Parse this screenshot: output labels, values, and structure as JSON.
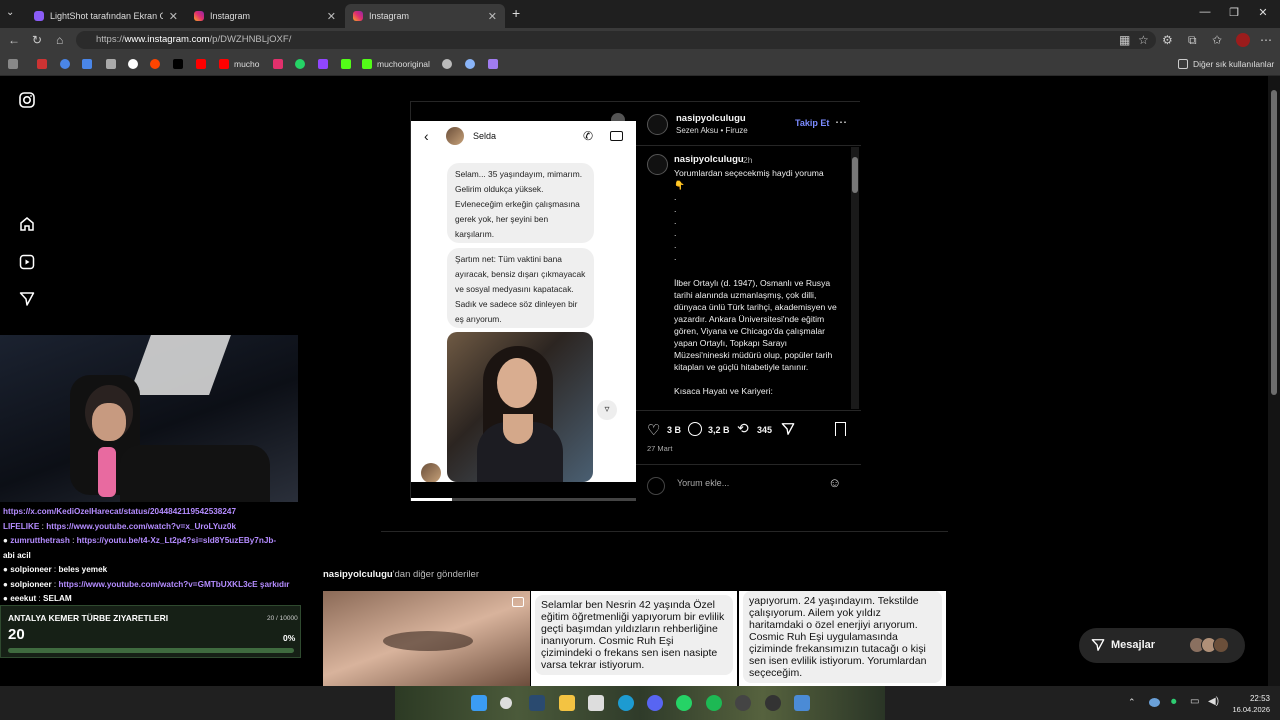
{
  "browser": {
    "tabs": [
      {
        "label": "LightShot tarafından Ekran Görünt",
        "active": false
      },
      {
        "label": "Instagram",
        "active": false
      },
      {
        "label": "Instagram",
        "active": true
      }
    ],
    "url_prefix": "https://",
    "url_domain": "www.instagram.com",
    "url_path": "/p/DWZHNBLjOXF/",
    "bookmarks": [
      "mucho",
      "muchooriginal"
    ],
    "other_bookmarks": "Diğer sık kullanılanlar"
  },
  "post": {
    "chat_contact": "Selda",
    "bubbles": [
      "Selam... 35 yaşındayım, mimarım. Gelirim oldukça yüksek. Evleneceğim erkeğin çalışmasına gerek yok, her şeyini ben karşılarım.",
      "Şartım net: Tüm vaktini bana ayıracak, bensiz dışarı çıkmayacak ve sosyal medyasını kapatacak. Sadık ve sadece söz dinleyen bir eş arıyorum."
    ],
    "author": "nasipyolculugu",
    "music": "Sezen Aksu • Firuze",
    "follow": "Takip Et",
    "caption_time": "2h",
    "caption_lines": [
      "Yorumlardan seçecekmiş haydi yoruma",
      "👇",
      ".",
      ".",
      ".",
      ".",
      ".",
      "."
    ],
    "caption_body": "İlber Ortaylı (d. 1947), Osmanlı ve Rusya tarihi alanında uzmanlaşmış, çok dilli, dünyaca ünlü Türk tarihçi, akademisyen ve yazardır. Ankara Üniversitesi'nde eğitim gören, Viyana ve Chicago'da çalışmalar yapan Ortaylı, Topkapı Sarayı Müzesi'nineski müdürü olup, popüler tarih kitapları ve güçlü hitabetiyle tanınır.",
    "caption_more": "Kısaca Hayatı ve Kariyeri:",
    "likes": "3 B",
    "comments": "3,2 B",
    "reposts": "345",
    "date": "27 Mart",
    "comment_placeholder": "Yorum ekle..."
  },
  "more_posts": {
    "author": "nasipyolculugu",
    "suffix": "'dan diğer gönderiler",
    "tile2": "Selamlar ben Nesrin 42 yaşında Özel eğitim öğretmenliği yapıyorum bir evlilik geçti başımdan yıldızların rehberliğine inanıyorum. Cosmic Ruh Eşi çizimindeki o frekans sen isen nasipte varsa tekrar istiyorum.",
    "tile3": "yapıyorum. 24 yaşındayım. Tekstilde çalışıyorum. Ailem yok yıldız haritamdaki o özel enerjiyi arıyorum. Cosmic Ruh Eşi uygulamasında çiziminde frekansımızın tutacağı o kişi sen isen evlilik istiyorum. Yorumlardan seçeceğim."
  },
  "messages_label": "Mesajlar",
  "stream": {
    "chat": [
      {
        "user": "",
        "text": "https://x.com/KediOzelHarecat/status/2044842119542538247",
        "ucolor": "#b48cff"
      },
      {
        "user": "LIFELIKE",
        "text": "https://www.youtube.com/watch?v=x_UroLYuz0k",
        "ucolor": "#b48cff"
      },
      {
        "user": "zumrutthetrash",
        "text": "https://youtu.be/t4-Xz_Lt2p4?si=sld8Y5uzEBy7nJb-",
        "ucolor": "#b48cff"
      },
      {
        "user": "",
        "text": "abi acil",
        "ucolor": "#ffffff"
      },
      {
        "user": "solpioneer",
        "text": "beles yemek",
        "ucolor": "#ffffff"
      },
      {
        "user": "solpioneer",
        "text": "https://www.youtube.com/watch?v=GMTbUXKL3cE şarkıdır",
        "ucolor": "#ffffff"
      },
      {
        "user": "eeekut",
        "text": "SELAM",
        "ucolor": "#ffffff"
      }
    ],
    "goal_title": "ANTALYA KEMER TÜRBE ZIYARETLERI",
    "goal_progress": "20 / 10000",
    "goal_value": "20",
    "goal_percent": "0%"
  },
  "taskbar": {
    "time": "22:53",
    "date": "16.04.2026"
  }
}
